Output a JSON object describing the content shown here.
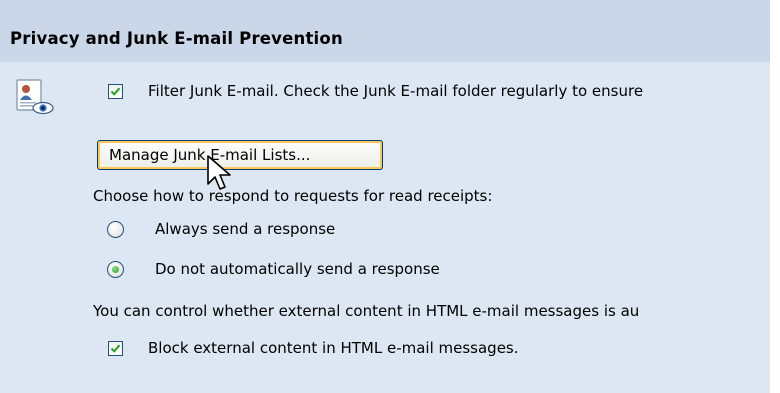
{
  "section": {
    "title": "Privacy and Junk E-mail Prevention"
  },
  "junk_filter": {
    "checkbox_label": "Filter Junk E-mail. Check the Junk E-mail folder regularly to ensure",
    "checked": true
  },
  "manage_button": {
    "label": "Manage Junk E-mail Lists..."
  },
  "read_receipts": {
    "prompt": "Choose how to respond to requests for read receipts:",
    "options": [
      {
        "label": "Always send a response",
        "selected": false
      },
      {
        "label": "Do not automatically send a response",
        "selected": true
      }
    ]
  },
  "external_content": {
    "description": "You can control whether external content in HTML e-mail messages is au",
    "checkbox_label": "Block external content in HTML e-mail messages.",
    "checked": true
  },
  "colors": {
    "header_bg": "#c9d7e8",
    "panel_bg": "#dde7f3",
    "check_green": "#21a121",
    "button_focus": "#f8c85a"
  },
  "icons": {
    "section": "privacy-contact-eye-icon",
    "cursor": "mouse-pointer-icon"
  }
}
